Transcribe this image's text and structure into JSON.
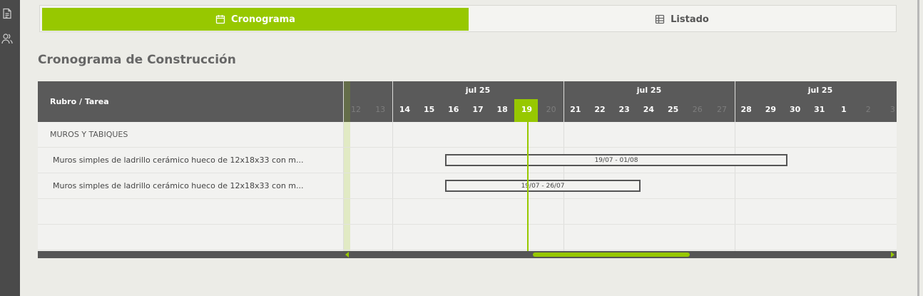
{
  "tabs": {
    "cronograma_label": "Cronograma",
    "listado_label": "Listado"
  },
  "page": {
    "title": "Cronograma de Construcción"
  },
  "gantt": {
    "column_header": "Rubro / Tarea",
    "months": [
      "jul 25",
      "jul 25",
      "jul 25"
    ],
    "days": [
      {
        "label": "12",
        "dim": true
      },
      {
        "label": "13",
        "dim": true
      },
      {
        "label": "14",
        "dim": false
      },
      {
        "label": "15",
        "dim": false
      },
      {
        "label": "16",
        "dim": false
      },
      {
        "label": "17",
        "dim": false
      },
      {
        "label": "18",
        "dim": false
      },
      {
        "label": "19",
        "dim": false
      },
      {
        "label": "20",
        "dim": true
      },
      {
        "label": "21",
        "dim": false
      },
      {
        "label": "22",
        "dim": false
      },
      {
        "label": "23",
        "dim": false
      },
      {
        "label": "24",
        "dim": false
      },
      {
        "label": "25",
        "dim": false
      },
      {
        "label": "26",
        "dim": true
      },
      {
        "label": "27",
        "dim": true
      },
      {
        "label": "28",
        "dim": false
      },
      {
        "label": "29",
        "dim": false
      },
      {
        "label": "30",
        "dim": false
      },
      {
        "label": "31",
        "dim": false
      },
      {
        "label": "1",
        "dim": false
      },
      {
        "label": "2",
        "dim": true
      },
      {
        "label": "3",
        "dim": true
      }
    ],
    "group": "MUROS Y TABIQUES",
    "tasks": [
      {
        "label": "Muros simples de ladrillo cerámico hueco de 12x18x33 con m...",
        "range": "19/07 - 01/08"
      },
      {
        "label": "Muros simples de ladrillo cerámico hueco de 12x18x33 con m...",
        "range": "19/07 - 26/07"
      }
    ]
  },
  "colors": {
    "accent": "#97c800",
    "header": "#5a5a5a"
  }
}
